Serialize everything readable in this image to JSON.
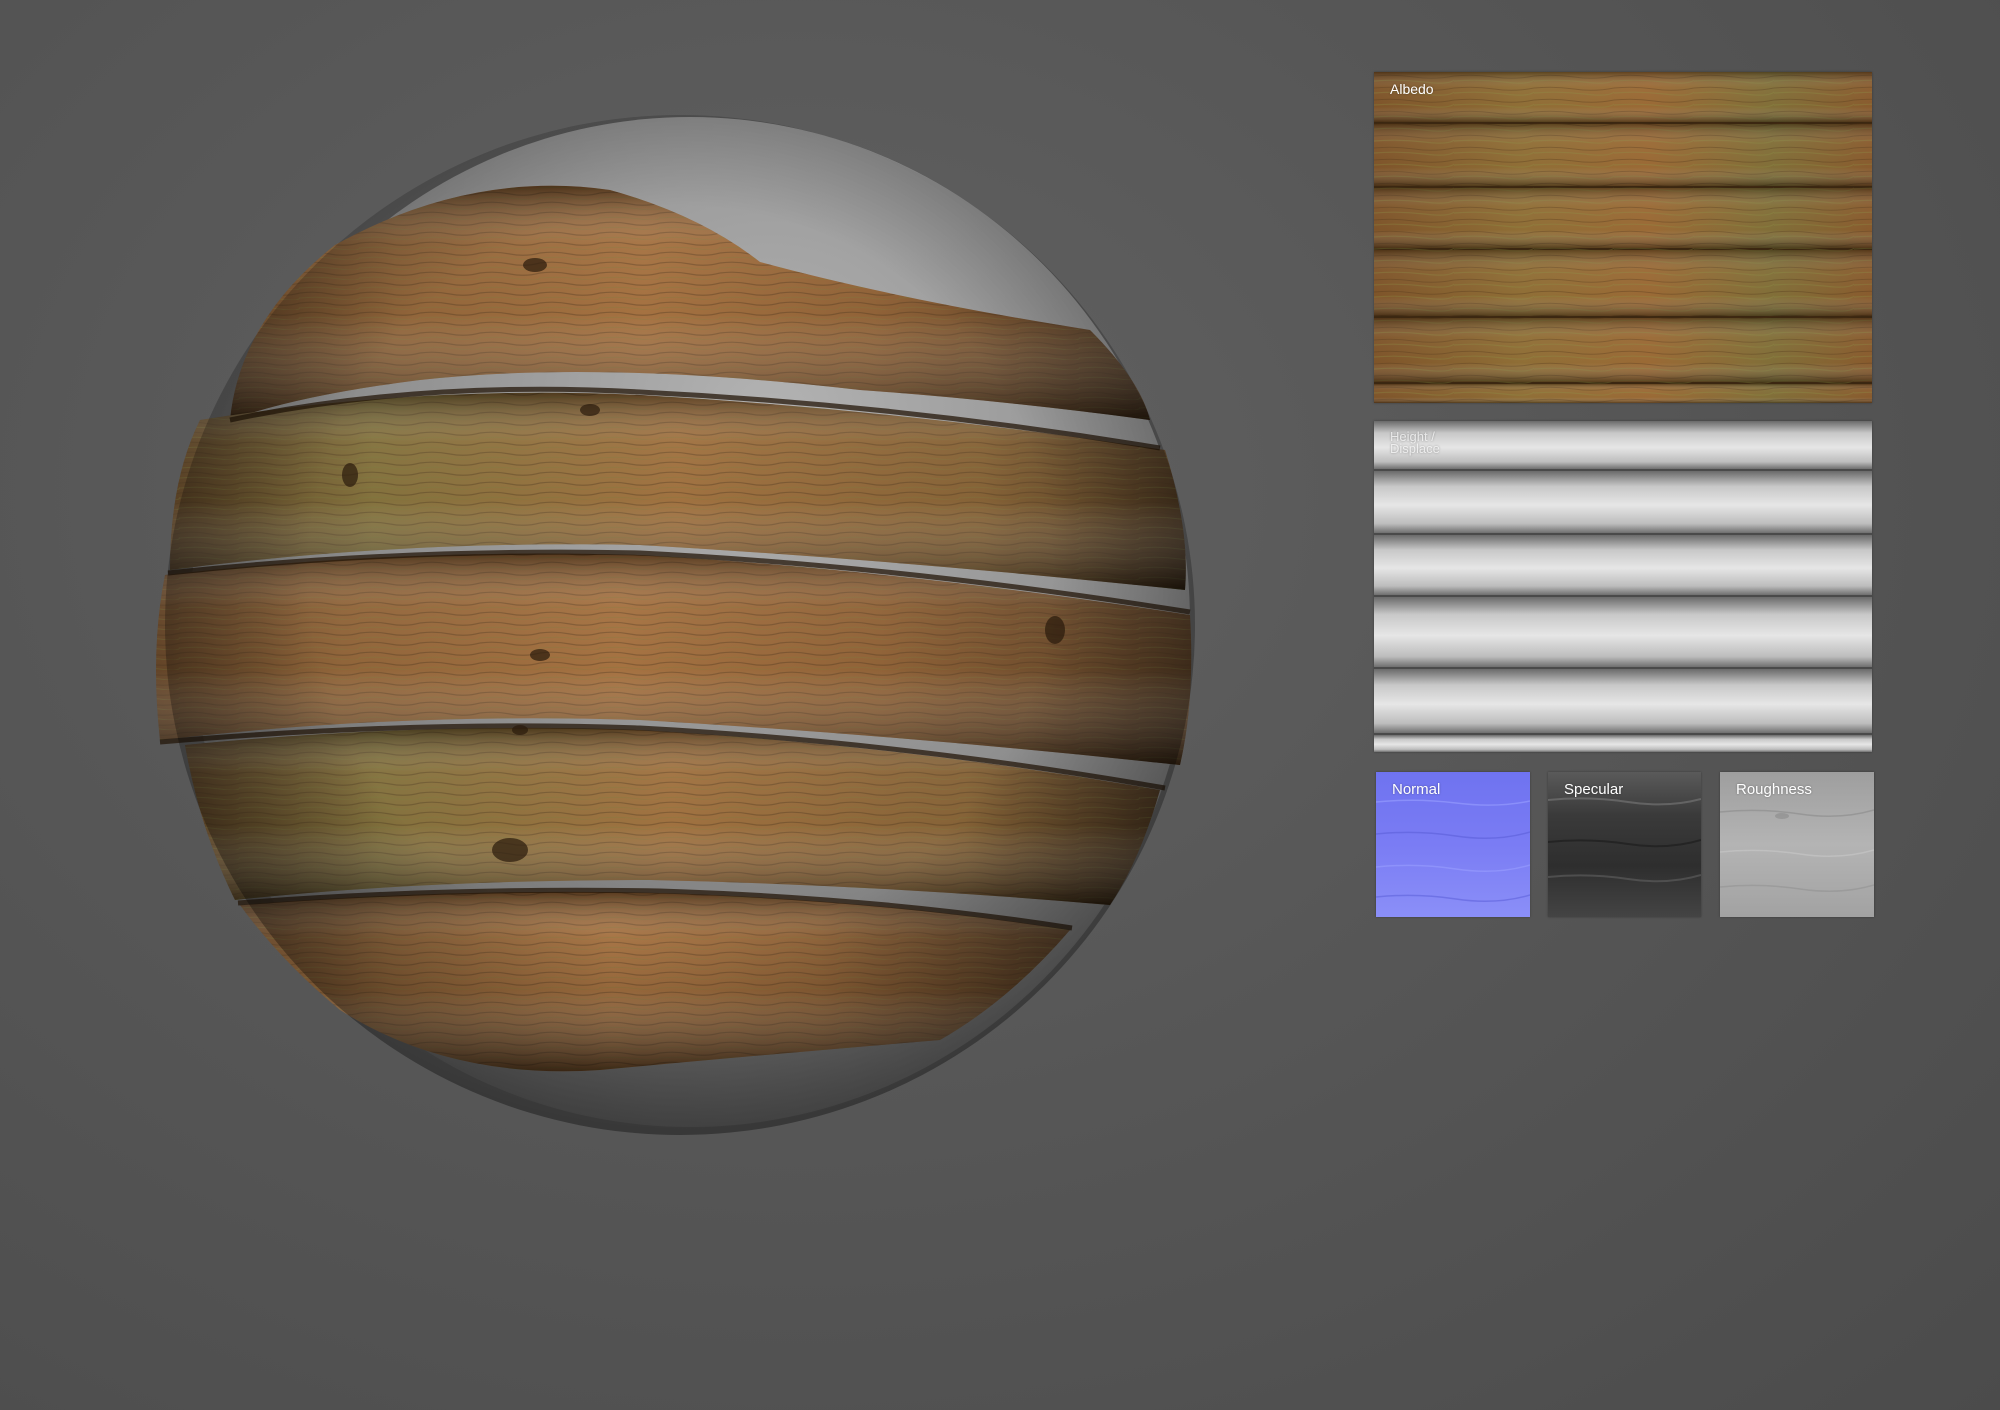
{
  "maps": {
    "albedo": {
      "label": "Albedo"
    },
    "height": {
      "label": "Height /\nDisplace"
    },
    "normal": {
      "label": "Normal"
    },
    "specular": {
      "label": "Specular"
    },
    "roughness": {
      "label": "Roughness"
    }
  },
  "colors": {
    "background": "#575757",
    "sphere_gray": "#9a9a9a",
    "wood": "#8a5a2e",
    "moss": "#7f7a3a",
    "normal_map": "#7a7cf2"
  },
  "icons": {
    "preview": "material-sphere-preview"
  }
}
